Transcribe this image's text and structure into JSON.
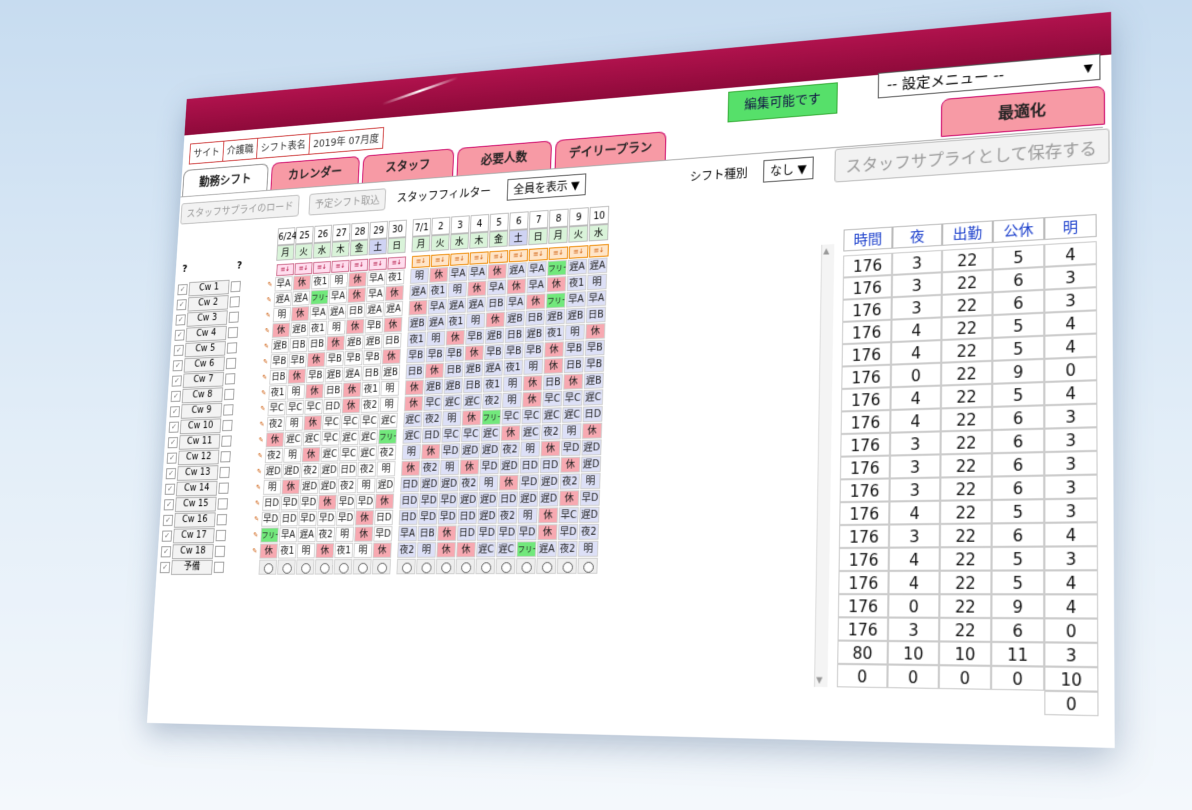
{
  "header": {
    "info": [
      "サイト",
      "介護職",
      "シフト表名",
      "2019年 07月度"
    ],
    "editable_status": "編集可能です",
    "settings_menu": "-- 設定メニュー --",
    "optimize_button": "最適化"
  },
  "tabs": [
    "勤務シフト",
    "カレンダー",
    "スタッフ",
    "必要人数",
    "デイリープラン"
  ],
  "toolbar": {
    "load_supply_button": "スタッフサプライのロード",
    "import_schedule_button": "予定シフト取込",
    "staff_filter_label": "スタッフフィルター",
    "staff_filter_value": "全員を表示",
    "shift_type_label": "シフト種別",
    "shift_type_value": "なし",
    "save_supply_button": "スタッフサプライとして保存する"
  },
  "dates": [
    "6/24",
    "25",
    "26",
    "27",
    "28",
    "29",
    "30",
    "7/1",
    "2",
    "3",
    "4",
    "5",
    "6",
    "7",
    "8",
    "9",
    "10"
  ],
  "weekdays": [
    "月",
    "火",
    "水",
    "木",
    "金",
    "土",
    "日",
    "月",
    "火",
    "水",
    "木",
    "金",
    "土",
    "日",
    "月",
    "火",
    "水"
  ],
  "question_marks": [
    "?",
    "?"
  ],
  "staff": [
    "Cw 1",
    "Cw 2",
    "Cw 3",
    "Cw 4",
    "Cw 5",
    "Cw 6",
    "Cw 7",
    "Cw 8",
    "Cw 9",
    "Cw 10",
    "Cw 11",
    "Cw 12",
    "Cw 13",
    "Cw 14",
    "Cw 15",
    "Cw 16",
    "Cw 17",
    "Cw 18",
    "予備"
  ],
  "shifts": [
    [
      "早A",
      "休",
      "夜1",
      "明",
      "休",
      "早A",
      "夜1",
      "明",
      "休",
      "早A",
      "早A",
      "休",
      "遅A",
      "早A",
      "フリー",
      "遅A",
      "遅A"
    ],
    [
      "遅A",
      "遅A",
      "フリー",
      "早A",
      "休",
      "早A",
      "休",
      "遅A",
      "夜1",
      "明",
      "休",
      "早A",
      "休",
      "早A",
      "休",
      "夜1",
      "明"
    ],
    [
      "明",
      "休",
      "早A",
      "遅A",
      "日B",
      "遅A",
      "遅A",
      "休",
      "早A",
      "遅A",
      "遅A",
      "日B",
      "早A",
      "休",
      "フリー",
      "早A",
      "早A"
    ],
    [
      "休",
      "遅B",
      "夜1",
      "明",
      "休",
      "早B",
      "休",
      "遅B",
      "遅A",
      "夜1",
      "明",
      "休",
      "遅B",
      "日B",
      "遅B",
      "遅B",
      "日B"
    ],
    [
      "遅B",
      "日B",
      "日B",
      "休",
      "遅B",
      "遅B",
      "日B",
      "夜1",
      "明",
      "休",
      "早B",
      "遅B",
      "日B",
      "遅B",
      "夜1",
      "明",
      "休"
    ],
    [
      "早B",
      "早B",
      "休",
      "早B",
      "早B",
      "早B",
      "休",
      "早B",
      "早B",
      "早B",
      "休",
      "早B",
      "早B",
      "早B",
      "休",
      "早B",
      "早B"
    ],
    [
      "日B",
      "休",
      "早B",
      "遅B",
      "遅A",
      "日B",
      "遅B",
      "日B",
      "休",
      "日B",
      "遅B",
      "遅A",
      "夜1",
      "明",
      "休",
      "日B",
      "早B"
    ],
    [
      "夜1",
      "明",
      "休",
      "日B",
      "休",
      "夜1",
      "明",
      "休",
      "遅B",
      "遅B",
      "日B",
      "夜1",
      "明",
      "休",
      "日B",
      "休",
      "遅B"
    ],
    [
      "早C",
      "早C",
      "早C",
      "日D",
      "休",
      "夜2",
      "明",
      "休",
      "早C",
      "遅C",
      "遅C",
      "夜2",
      "明",
      "休",
      "早C",
      "早C",
      "遅C"
    ],
    [
      "夜2",
      "明",
      "休",
      "早C",
      "早C",
      "早C",
      "遅C",
      "遅C",
      "夜2",
      "明",
      "休",
      "フリー",
      "早C",
      "早C",
      "遅C",
      "遅C",
      "日D"
    ],
    [
      "休",
      "遅C",
      "遅C",
      "早C",
      "遅C",
      "遅C",
      "フリー",
      "遅C",
      "日D",
      "早C",
      "早C",
      "遅C",
      "休",
      "遅C",
      "夜2",
      "明",
      "休"
    ],
    [
      "夜2",
      "明",
      "休",
      "遅C",
      "早C",
      "遅C",
      "夜2",
      "明",
      "休",
      "早D",
      "遅D",
      "遅D",
      "夜2",
      "明",
      "休",
      "早D",
      "遅D"
    ],
    [
      "遅D",
      "遅D",
      "夜2",
      "遅D",
      "日D",
      "夜2",
      "明",
      "休",
      "夜2",
      "明",
      "休",
      "早D",
      "遅D",
      "日D",
      "日D",
      "休",
      "遅D"
    ],
    [
      "明",
      "休",
      "遅D",
      "遅D",
      "夜2",
      "明",
      "遅D",
      "日D",
      "遅D",
      "遅D",
      "夜2",
      "明",
      "休",
      "早D",
      "遅D",
      "夜2",
      "明"
    ],
    [
      "日D",
      "早D",
      "早D",
      "休",
      "早D",
      "早D",
      "休",
      "日D",
      "早D",
      "早D",
      "遅D",
      "遅D",
      "日D",
      "遅D",
      "遅D",
      "休",
      "早D"
    ],
    [
      "早D",
      "日D",
      "早D",
      "早D",
      "早D",
      "休",
      "日D",
      "日D",
      "早D",
      "早D",
      "日D",
      "遅D",
      "夜2",
      "明",
      "休",
      "早C",
      "遅D"
    ],
    [
      "フリー",
      "早A",
      "遅A",
      "夜2",
      "明",
      "休",
      "早D",
      "早A",
      "日B",
      "休",
      "日D",
      "早D",
      "早D",
      "早D",
      "休",
      "早D",
      "夜2"
    ],
    [
      "休",
      "夜1",
      "明",
      "休",
      "夜1",
      "明",
      "休",
      "夜2",
      "明",
      "休",
      "休",
      "遅C",
      "遅C",
      "フリー",
      "遅A",
      "夜2",
      "明"
    ],
    [
      "○",
      "○",
      "○",
      "○",
      "○",
      "○",
      "○",
      "○",
      "○",
      "○",
      "○",
      "○",
      "○",
      "○",
      "○",
      "○",
      "○"
    ]
  ],
  "stats": {
    "headers": [
      "時間",
      "夜",
      "出勤",
      "公休",
      "明"
    ],
    "rows": [
      [
        "176",
        "3",
        "22",
        "5",
        "4"
      ],
      [
        "176",
        "3",
        "22",
        "6",
        "3"
      ],
      [
        "176",
        "3",
        "22",
        "6",
        "3"
      ],
      [
        "176",
        "4",
        "22",
        "5",
        "4"
      ],
      [
        "176",
        "4",
        "22",
        "5",
        "4"
      ],
      [
        "176",
        "0",
        "22",
        "9",
        "0"
      ],
      [
        "176",
        "4",
        "22",
        "5",
        "4"
      ],
      [
        "176",
        "4",
        "22",
        "6",
        "3"
      ],
      [
        "176",
        "3",
        "22",
        "6",
        "3"
      ],
      [
        "176",
        "3",
        "22",
        "6",
        "3"
      ],
      [
        "176",
        "3",
        "22",
        "6",
        "3"
      ],
      [
        "176",
        "4",
        "22",
        "5",
        "3"
      ],
      [
        "176",
        "3",
        "22",
        "6",
        "4"
      ],
      [
        "176",
        "4",
        "22",
        "5",
        "3"
      ],
      [
        "176",
        "4",
        "22",
        "5",
        "4"
      ],
      [
        "176",
        "0",
        "22",
        "9",
        "4"
      ],
      [
        "176",
        "3",
        "22",
        "6",
        "0"
      ],
      [
        "80",
        "10",
        "10",
        "11",
        "3"
      ],
      [
        "0",
        "0",
        "0",
        "0",
        "10"
      ],
      [
        "",
        "",
        "",
        "",
        "0"
      ]
    ]
  }
}
